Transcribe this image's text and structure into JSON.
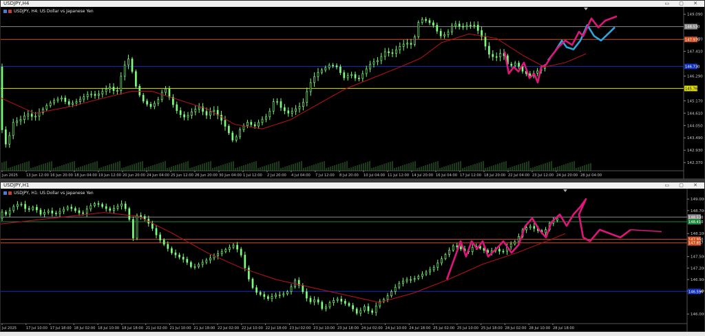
{
  "windows": [
    {
      "title": "USDJPY,H4",
      "symbol_title": "USDJPY, H4:  US Dollar vs Japanese Yen",
      "price_ticks": [
        "149.090",
        "147.970",
        "147.410",
        "146.290",
        "145.170",
        "144.610",
        "144.050",
        "143.490",
        "142.930",
        "142.370"
      ],
      "tick_values": [
        149.09,
        147.97,
        147.41,
        146.29,
        145.17,
        144.61,
        144.05,
        143.49,
        142.93,
        142.37
      ],
      "price_badges": [
        {
          "label": "148.530",
          "value": 148.53,
          "color": "#8a8a8a"
        },
        {
          "label": "147.970",
          "value": 147.95,
          "color": "#d05020"
        },
        {
          "label": "146.730",
          "value": 146.73,
          "color": "#1030c0"
        },
        {
          "label": "145.760",
          "value": 145.73,
          "color": "#e0e000"
        }
      ],
      "time_labels": [
        "Jun 2025",
        "13 Jun 12:00",
        "16 Jun 20:00",
        "18 Jun 04:00",
        "19 Jun 12:00",
        "20 Jun 20:00",
        "24 Jun 04:00",
        "25 Jun 12:00",
        "26 Jun 20:00",
        "30 Jun 04:00",
        "1 Jul 12:00",
        "2 Jul 20:00",
        "4 Jul 04:00",
        "7 Jul 12:00",
        "8 Jul 20:00",
        "10 Jul 04:00",
        "11 Jul 12:00",
        "14 Jul 20:00",
        "16 Jul 04:00",
        "17 Jul 12:00",
        "18 Jul 20:00",
        "22 Jul 04:00",
        "23 Jul 12:00",
        "24 Jul 20:00",
        "28 Jul 04:00"
      ],
      "price_range": [
        142.0,
        149.3
      ]
    },
    {
      "title": "USDJPY,H1",
      "symbol_title": "USDJPY, H1:  US Dollar vs Japanese Yen",
      "price_ticks": [
        "149.000",
        "148.700",
        "148.100",
        "147.500",
        "147.200",
        "146.900",
        "146.600",
        "146.000"
      ],
      "tick_values": [
        149.0,
        148.7,
        148.1,
        147.5,
        147.2,
        146.9,
        146.6,
        146.0
      ],
      "price_badges": [
        {
          "label": "148.530",
          "value": 148.53,
          "color": "#8a8a8a"
        },
        {
          "label": "148.410",
          "value": 148.41,
          "color": "#1a8a3a"
        },
        {
          "label": "147.950",
          "value": 147.95,
          "color": "#d05020"
        },
        {
          "label": "147.857",
          "value": 147.857,
          "color": "#d05020"
        },
        {
          "label": "146.590",
          "value": 146.59,
          "color": "#1030c0"
        }
      ],
      "time_labels": [
        "Jul 2025",
        "17 Jul 10:00",
        "17 Jul 18:00",
        "18 Jul 02:00",
        "18 Jul 10:00",
        "18 Jul 18:00",
        "21 Jul 02:00",
        "21 Jul 10:00",
        "21 Jul 18:00",
        "22 Jul 02:00",
        "22 Jul 10:00",
        "22 Jul 18:00",
        "23 Jul 02:00",
        "23 Jul 10:00",
        "23 Jul 18:00",
        "24 Jul 02:00",
        "24 Jul 10:00",
        "24 Jul 18:00",
        "25 Jul 02:00",
        "25 Jul 10:00",
        "25 Jul 18:00",
        "28 Jul 02:00",
        "28 Jul 10:00",
        "28 Jul 18:00"
      ],
      "price_range": [
        145.75,
        149.2
      ]
    }
  ],
  "colors": {
    "background": "#000000",
    "bull": "#7cfc7c",
    "ma": "#c0101a",
    "forecast_pink": "#e0157c",
    "forecast_blue": "#2aa8e0",
    "grey_level": "#8a8a8a",
    "orange_level": "#d05020",
    "blue_level": "#1030c0",
    "yellow_level": "#e0e000",
    "green_level": "#1a8a3a"
  },
  "chart_data": [
    {
      "type": "candlestick",
      "title": "USDJPY, H4: US Dollar vs Japanese Yen",
      "ylim": [
        142.0,
        149.3
      ],
      "close_path": [
        [
          0,
          144.3
        ],
        [
          10,
          143.1
        ],
        [
          20,
          144.2
        ],
        [
          30,
          144.3
        ],
        [
          40,
          144.6
        ],
        [
          50,
          144.4
        ],
        [
          60,
          144.7
        ],
        [
          70,
          145.0
        ],
        [
          80,
          145.2
        ],
        [
          90,
          145.3
        ],
        [
          100,
          145.0
        ],
        [
          110,
          145.1
        ],
        [
          120,
          145.3
        ],
        [
          130,
          145.5
        ],
        [
          140,
          145.4
        ],
        [
          150,
          145.6
        ],
        [
          160,
          145.8
        ],
        [
          170,
          145.5
        ],
        [
          180,
          146.7
        ],
        [
          188,
          147.1
        ],
        [
          195,
          146.2
        ],
        [
          200,
          145.6
        ],
        [
          210,
          145.1
        ],
        [
          220,
          144.9
        ],
        [
          230,
          145.2
        ],
        [
          240,
          145.8
        ],
        [
          250,
          145.1
        ],
        [
          260,
          144.6
        ],
        [
          270,
          144.4
        ],
        [
          280,
          144.7
        ],
        [
          290,
          144.9
        ],
        [
          300,
          144.5
        ],
        [
          310,
          144.8
        ],
        [
          320,
          144.4
        ],
        [
          330,
          143.9
        ],
        [
          340,
          143.3
        ],
        [
          350,
          143.9
        ],
        [
          360,
          144.2
        ],
        [
          370,
          144.0
        ],
        [
          380,
          144.3
        ],
        [
          390,
          144.5
        ],
        [
          400,
          145.3
        ],
        [
          410,
          144.8
        ],
        [
          420,
          144.6
        ],
        [
          430,
          144.8
        ],
        [
          440,
          145.0
        ],
        [
          450,
          145.9
        ],
        [
          460,
          146.4
        ],
        [
          470,
          146.6
        ],
        [
          480,
          146.8
        ],
        [
          490,
          146.7
        ],
        [
          500,
          146.2
        ],
        [
          510,
          146.4
        ],
        [
          520,
          146.1
        ],
        [
          530,
          146.5
        ],
        [
          540,
          146.9
        ],
        [
          550,
          147.0
        ],
        [
          560,
          147.4
        ],
        [
          570,
          147.3
        ],
        [
          580,
          147.6
        ],
        [
          590,
          147.8
        ],
        [
          600,
          147.7
        ],
        [
          610,
          148.9
        ],
        [
          620,
          148.8
        ],
        [
          630,
          148.6
        ],
        [
          640,
          148.1
        ],
        [
          650,
          148.2
        ],
        [
          660,
          148.7
        ],
        [
          670,
          148.5
        ],
        [
          680,
          148.6
        ],
        [
          690,
          148.6
        ],
        [
          700,
          148.1
        ],
        [
          710,
          147.3
        ],
        [
          720,
          147.1
        ],
        [
          730,
          147.4
        ],
        [
          740,
          146.7
        ],
        [
          750,
          146.9
        ],
        [
          760,
          146.5
        ],
        [
          770,
          146.3
        ],
        [
          780,
          146.5
        ],
        [
          790,
          146.7
        ]
      ],
      "ma_path": [
        [
          0,
          145.3
        ],
        [
          50,
          144.6
        ],
        [
          100,
          144.9
        ],
        [
          150,
          145.3
        ],
        [
          190,
          145.6
        ],
        [
          220,
          145.6
        ],
        [
          260,
          145.2
        ],
        [
          300,
          144.8
        ],
        [
          340,
          144.1
        ],
        [
          380,
          143.9
        ],
        [
          420,
          144.3
        ],
        [
          460,
          145.0
        ],
        [
          500,
          145.7
        ],
        [
          540,
          146.2
        ],
        [
          580,
          146.7
        ],
        [
          610,
          147.1
        ],
        [
          640,
          147.8
        ],
        [
          680,
          148.2
        ],
        [
          720,
          148.0
        ],
        [
          760,
          147.2
        ],
        [
          790,
          146.7
        ],
        [
          820,
          146.9
        ],
        [
          850,
          147.3
        ]
      ],
      "forecast_pink": [
        [
          732,
          147.4
        ],
        [
          738,
          146.4
        ],
        [
          745,
          146.7
        ],
        [
          752,
          146.5
        ],
        [
          760,
          146.9
        ],
        [
          768,
          146.2
        ],
        [
          775,
          146.4
        ],
        [
          780,
          146.0
        ],
        [
          785,
          146.7
        ],
        [
          792,
          146.8
        ],
        [
          800,
          147.2
        ],
        [
          810,
          147.6
        ],
        [
          820,
          147.9
        ],
        [
          830,
          147.7
        ],
        [
          840,
          148.3
        ],
        [
          846,
          148.1
        ],
        [
          858,
          148.9
        ],
        [
          868,
          148.5
        ],
        [
          878,
          148.8
        ],
        [
          895,
          149.0
        ]
      ],
      "forecast_blue": [
        [
          795,
          147.0
        ],
        [
          805,
          147.4
        ],
        [
          815,
          147.9
        ],
        [
          822,
          147.6
        ],
        [
          832,
          147.5
        ],
        [
          842,
          147.9
        ],
        [
          852,
          148.6
        ],
        [
          862,
          148.1
        ],
        [
          872,
          147.9
        ],
        [
          882,
          148.2
        ],
        [
          892,
          148.5
        ]
      ],
      "levels": [
        148.53,
        147.95,
        146.73,
        145.73
      ]
    },
    {
      "type": "candlestick",
      "title": "USDJPY, H1: US Dollar vs Japanese Yen",
      "ylim": [
        145.75,
        149.2
      ],
      "close_path": [
        [
          0,
          148.7
        ],
        [
          10,
          148.6
        ],
        [
          20,
          148.8
        ],
        [
          30,
          148.9
        ],
        [
          40,
          148.7
        ],
        [
          50,
          148.8
        ],
        [
          60,
          148.6
        ],
        [
          70,
          148.7
        ],
        [
          80,
          148.6
        ],
        [
          90,
          148.7
        ],
        [
          100,
          148.8
        ],
        [
          110,
          148.7
        ],
        [
          120,
          148.6
        ],
        [
          130,
          148.8
        ],
        [
          140,
          148.9
        ],
        [
          150,
          148.8
        ],
        [
          160,
          148.7
        ],
        [
          170,
          148.8
        ],
        [
          180,
          148.9
        ],
        [
          190,
          148.4
        ],
        [
          195,
          147.9
        ],
        [
          200,
          148.6
        ],
        [
          210,
          148.5
        ],
        [
          220,
          148.3
        ],
        [
          230,
          148.0
        ],
        [
          240,
          147.8
        ],
        [
          250,
          147.6
        ],
        [
          260,
          147.5
        ],
        [
          270,
          147.4
        ],
        [
          280,
          147.2
        ],
        [
          290,
          147.3
        ],
        [
          300,
          147.4
        ],
        [
          310,
          147.5
        ],
        [
          320,
          147.6
        ],
        [
          330,
          147.7
        ],
        [
          340,
          147.8
        ],
        [
          350,
          147.6
        ],
        [
          360,
          147.0
        ],
        [
          370,
          146.6
        ],
        [
          380,
          146.5
        ],
        [
          390,
          146.4
        ],
        [
          400,
          146.5
        ],
        [
          410,
          146.5
        ],
        [
          420,
          146.6
        ],
        [
          430,
          146.9
        ],
        [
          440,
          146.6
        ],
        [
          450,
          146.3
        ],
        [
          460,
          146.4
        ],
        [
          470,
          146.1
        ],
        [
          480,
          146.3
        ],
        [
          490,
          146.4
        ],
        [
          500,
          146.3
        ],
        [
          510,
          146.2
        ],
        [
          520,
          146.0
        ],
        [
          530,
          146.2
        ],
        [
          540,
          146.0
        ],
        [
          550,
          146.3
        ],
        [
          560,
          146.4
        ],
        [
          570,
          146.6
        ],
        [
          580,
          146.8
        ],
        [
          590,
          146.9
        ],
        [
          600,
          146.9
        ],
        [
          610,
          147.0
        ],
        [
          620,
          147.1
        ],
        [
          630,
          147.2
        ],
        [
          640,
          147.4
        ],
        [
          650,
          147.6
        ],
        [
          660,
          147.8
        ],
        [
          670,
          147.7
        ],
        [
          680,
          147.6
        ],
        [
          690,
          147.8
        ],
        [
          700,
          147.7
        ],
        [
          710,
          147.6
        ],
        [
          720,
          147.7
        ],
        [
          730,
          147.6
        ],
        [
          740,
          147.8
        ],
        [
          750,
          147.9
        ],
        [
          760,
          148.2
        ],
        [
          770,
          148.3
        ],
        [
          780,
          148.2
        ],
        [
          790,
          148.1
        ],
        [
          800,
          148.4
        ],
        [
          810,
          148.5
        ]
      ],
      "ma_path": [
        [
          0,
          148.35
        ],
        [
          50,
          148.45
        ],
        [
          100,
          148.55
        ],
        [
          150,
          148.65
        ],
        [
          200,
          148.55
        ],
        [
          250,
          148.1
        ],
        [
          300,
          147.6
        ],
        [
          350,
          147.2
        ],
        [
          400,
          146.9
        ],
        [
          450,
          146.7
        ],
        [
          500,
          146.5
        ],
        [
          550,
          146.3
        ],
        [
          600,
          146.55
        ],
        [
          650,
          146.9
        ],
        [
          700,
          147.3
        ],
        [
          750,
          147.6
        ],
        [
          800,
          147.95
        ],
        [
          820,
          148.1
        ]
      ],
      "forecast_pink": [
        [
          648,
          146.9
        ],
        [
          658,
          147.4
        ],
        [
          668,
          147.9
        ],
        [
          676,
          147.5
        ],
        [
          684,
          147.9
        ],
        [
          692,
          147.7
        ],
        [
          700,
          147.9
        ],
        [
          708,
          147.5
        ],
        [
          720,
          147.7
        ],
        [
          730,
          147.9
        ],
        [
          742,
          147.6
        ],
        [
          752,
          147.8
        ],
        [
          762,
          148.3
        ],
        [
          772,
          148.5
        ],
        [
          782,
          148.2
        ],
        [
          792,
          148.0
        ],
        [
          800,
          148.4
        ],
        [
          812,
          148.6
        ],
        [
          822,
          148.3
        ],
        [
          832,
          148.6
        ],
        [
          842,
          148.8
        ],
        [
          850,
          149.0
        ],
        [
          840,
          148.6
        ],
        [
          846,
          148.0
        ],
        [
          856,
          147.9
        ],
        [
          870,
          148.2
        ],
        [
          885,
          148.1
        ],
        [
          900,
          148.0
        ],
        [
          915,
          148.2
        ]
      ],
      "forecast_pink_tail": [
        [
          915,
          148.2
        ],
        [
          960,
          148.15
        ]
      ],
      "levels": [
        148.53,
        148.41,
        147.95,
        147.857,
        146.59
      ]
    }
  ]
}
